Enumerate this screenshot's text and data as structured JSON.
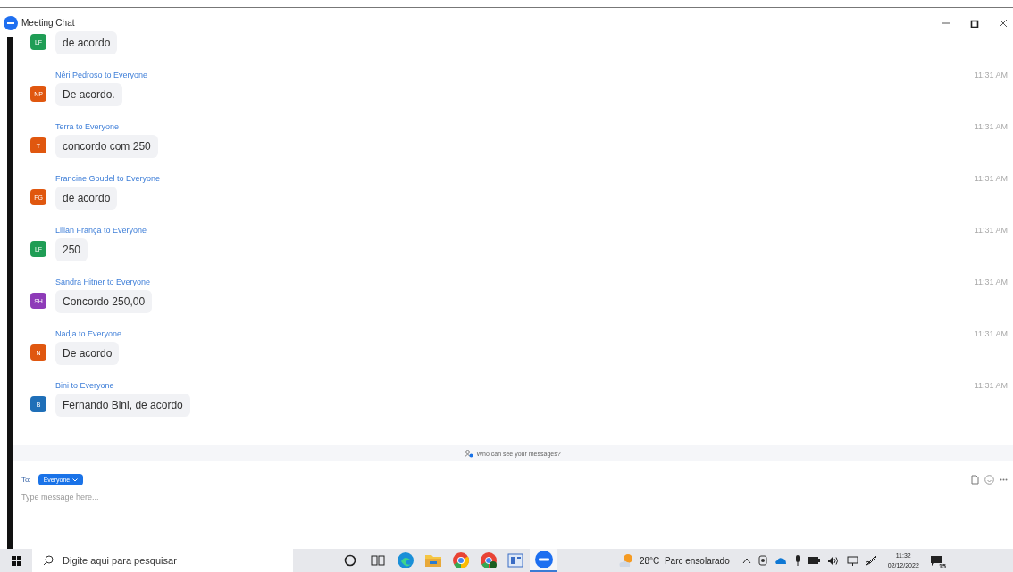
{
  "window": {
    "title": "Meeting Chat"
  },
  "messages": [
    {
      "initials": "LF",
      "color": "#1f9d55",
      "text": "de acordo"
    },
    {
      "header": "Nêri Pedroso to Everyone",
      "time": "11:31 AM",
      "initials": "NP",
      "color": "#e0570f",
      "text": "De acordo."
    },
    {
      "header": "Terra to Everyone",
      "time": "11:31 AM",
      "initials": "T",
      "color": "#e0570f",
      "text": "concordo com 250"
    },
    {
      "header": "Francine Goudel to Everyone",
      "time": "11:31 AM",
      "initials": "FG",
      "color": "#e0570f",
      "text": "de acordo"
    },
    {
      "header": "Lilian França to Everyone",
      "time": "11:31 AM",
      "initials": "LF",
      "color": "#1f9d55",
      "text": "250"
    },
    {
      "header": "Sandra Hitner to Everyone",
      "time": "11:31 AM",
      "initials": "SH",
      "color": "#8e3bb8",
      "text": "Concordo 250,00"
    },
    {
      "header": "Nadja to Everyone",
      "time": "11:31 AM",
      "initials": "N",
      "color": "#e0570f",
      "text": "De acordo"
    },
    {
      "header": "Bini to Everyone",
      "time": "11:31 AM",
      "initials": "B",
      "color": "#1f6fb8",
      "text": "Fernando Bini, de acordo"
    }
  ],
  "privacy_notice": "Who can see your messages?",
  "composer": {
    "to_label": "To:",
    "recipient": "Everyone",
    "placeholder": "Type message here..."
  },
  "taskbar": {
    "search_placeholder": "Digite aqui para pesquisar",
    "apps": [
      {
        "kind": "cortana",
        "selected": false
      },
      {
        "kind": "taskview",
        "selected": false
      },
      {
        "kind": "edge",
        "selected": false
      },
      {
        "kind": "folder",
        "selected": false
      },
      {
        "kind": "chrome",
        "selected": false
      },
      {
        "kind": "chrome-profile",
        "selected": false
      },
      {
        "kind": "document",
        "selected": false
      },
      {
        "kind": "meeting",
        "selected": true
      }
    ],
    "weather": "28°C  Parc ensolarado",
    "time": "11:32",
    "date": "02/12/2022",
    "notifications": "15"
  }
}
